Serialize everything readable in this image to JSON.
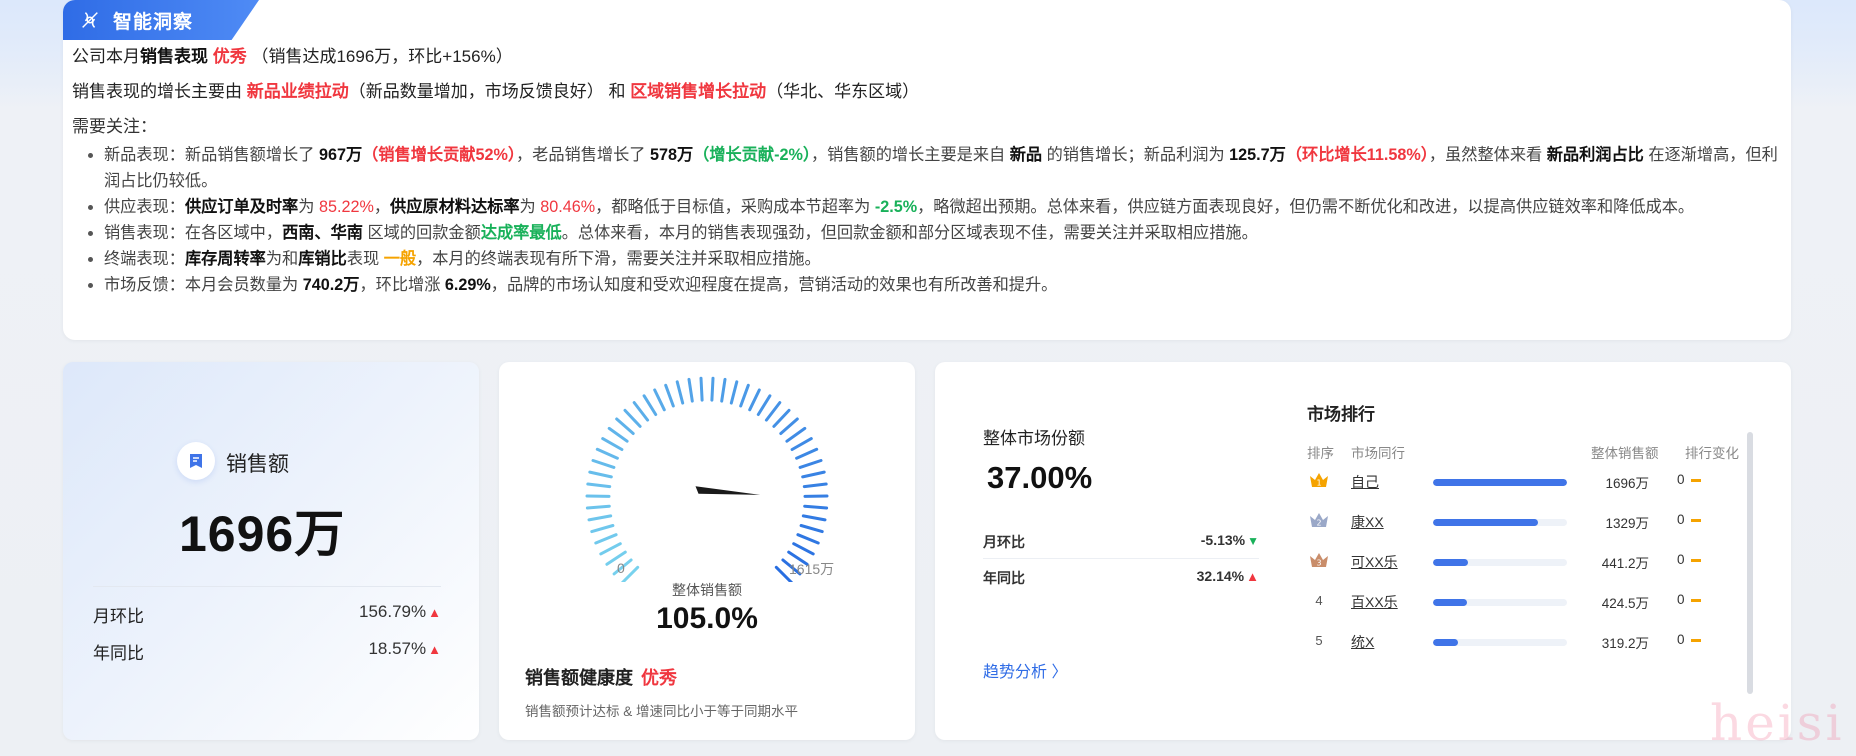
{
  "insight": {
    "badge": "智能洞察",
    "line1": {
      "pre": "公司本月",
      "b": "销售表现",
      "rating": "优秀",
      "post": "（销售达成1696万，环比+156%）"
    },
    "line2": {
      "pre": "销售表现的增长主要由 ",
      "factor1": "新品业绩拉动",
      "mid": "（新品数量增加，市场反馈良好） 和 ",
      "factor2": "区域销售增长拉动",
      "post": "（华北、华东区域）"
    },
    "line3": "需要关注：",
    "b1": {
      "t1": "新品表现：新品销售额增长了 ",
      "v1": "967万",
      "v1b": "（销售增长贡献52%）",
      "t2": "，老品销售增长了 ",
      "v2": "578万",
      "v2b": "（增长贡献-2%）",
      "t3": "，销售额的增长主要是来自 ",
      "v3": "新品",
      "t4": " 的销售增长；新品利润为 ",
      "v4": "125.7万",
      "v4b": "（环比增长11.58%）",
      "t5": "，虽然整体来看 ",
      "v5": "新品利润占比",
      "t6": " 在逐渐增高，但利润占比仍较低。"
    },
    "b2": {
      "t1": "供应表现：",
      "v1": "供应订单及时率",
      "t2": "为 ",
      "v2": "85.22%",
      "t3": "，",
      "v3": "供应原材料达标率",
      "t4": "为 ",
      "v4": "80.46%",
      "t5": "，都略低于目标值，采购成本节超率为 ",
      "v5": "-2.5%",
      "t6": "，略微超出预期。总体来看，供应链方面表现良好，但仍需不断优化和改进，以提高供应链效率和降低成本。"
    },
    "b3": {
      "t1": "销售表现：在各区域中，",
      "v1": "西南、华南",
      "t2": " 区域的回款金额",
      "v2": "达成率最低",
      "t3": "。总体来看，本月的销售表现强劲，但回款金额和部分区域表现不佳，需要关注并采取相应措施。"
    },
    "b4": {
      "t1": "终端表现：",
      "v1": "库存周转率",
      "t2": "为和",
      "v2": "库销比",
      "t3": "表现 ",
      "v3": "一般",
      "t4": "，本月的终端表现有所下滑，需要关注并采取相应措施。"
    },
    "b5": {
      "t1": "市场反馈：本月会员数量为 ",
      "v1": "740.2万",
      "t2": "，环比增涨 ",
      "v2": "6.29%",
      "t3": "，品牌的市场认知度和受欢迎程度在提高，营销活动的效果也有所改善和提升。"
    }
  },
  "sales": {
    "label": "销售额",
    "value": "1696万",
    "mom_label": "月环比",
    "mom_value": "156.79%",
    "yoy_label": "年同比",
    "yoy_value": "18.57%"
  },
  "gauge": {
    "min_label": "0",
    "max_label": "1615万",
    "caption": "整体销售额",
    "value_label": "105.0%",
    "percent": 105.0,
    "health_label": "销售额健康度",
    "health_rating": "优秀",
    "note": "销售额预计达标 & 增速同比小于等于同期水平"
  },
  "market": {
    "title": "整体市场份额",
    "value": "37.00%",
    "mom_label": "月环比",
    "mom_value": "-5.13%",
    "yoy_label": "年同比",
    "yoy_value": "32.14%",
    "trend_link": "趋势分析",
    "rank_title": "市场排行",
    "headers": {
      "idx": "排序",
      "name": "市场同行",
      "amount": "整体销售额",
      "change": "排行变化"
    },
    "rows": [
      {
        "idx": "",
        "medal": "gold",
        "name": "自己",
        "amount": "1696万",
        "amount_num": 1696,
        "change": "0"
      },
      {
        "idx": "",
        "medal": "silver",
        "name": "康XX",
        "amount": "1329万",
        "amount_num": 1329,
        "change": "0"
      },
      {
        "idx": "",
        "medal": "bronze",
        "name": "可XX乐",
        "amount": "441.2万",
        "amount_num": 441.2,
        "change": "0"
      },
      {
        "idx": "4",
        "medal": "",
        "name": "百XX乐",
        "amount": "424.5万",
        "amount_num": 424.5,
        "change": "0"
      },
      {
        "idx": "5",
        "medal": "",
        "name": "统X",
        "amount": "319.2万",
        "amount_num": 319.2,
        "change": "0"
      }
    ]
  },
  "colors": {
    "accent": "#2f6ce6",
    "red": "#f0373f",
    "green": "#19b15a",
    "orange": "#f5a300",
    "bar": "#3f74e8"
  },
  "watermark": "heisi"
}
